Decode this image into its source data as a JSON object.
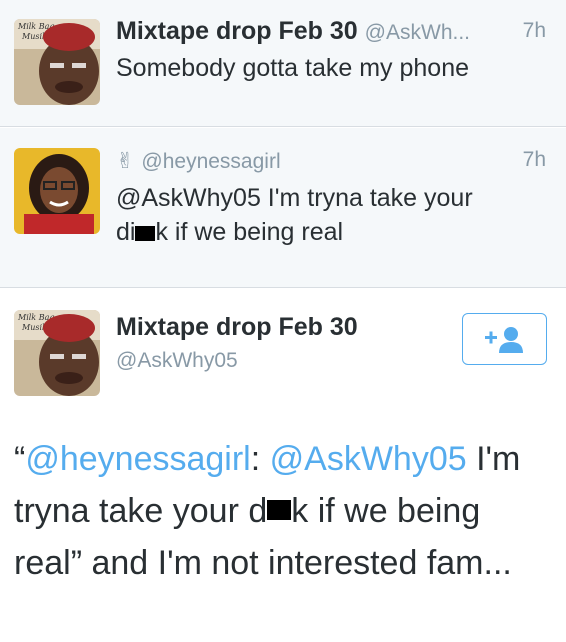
{
  "tweets": [
    {
      "name": "Mixtape drop Feb 30",
      "handle": "@AskWh...",
      "time": "7h",
      "text": "Somebody gotta take my phone",
      "avatar_icon": "milk-bag-musik-avatar"
    },
    {
      "emoji": "✌",
      "handle": "@heynessagirl",
      "time": "7h",
      "text_line1": "@AskWhy05 I'm tryna take your",
      "text_line2_a": "di",
      "text_line2_b": "k if we being real",
      "avatar_icon": "woman-avatar"
    }
  ],
  "main_tweet": {
    "name": "Mixtape drop Feb 30",
    "handle": "@AskWhy05",
    "follow_icon": "add-user-icon",
    "quote_open": "“",
    "mention1": "@heynessagirl",
    "colon": ": ",
    "mention2": "@AskWhy05",
    "text_a": " I'm tryna take your d",
    "text_b": "k if we being real” and I'm not interested fam..."
  },
  "colors": {
    "link": "#55acee",
    "muted": "#8899a6",
    "text": "#292f33"
  }
}
